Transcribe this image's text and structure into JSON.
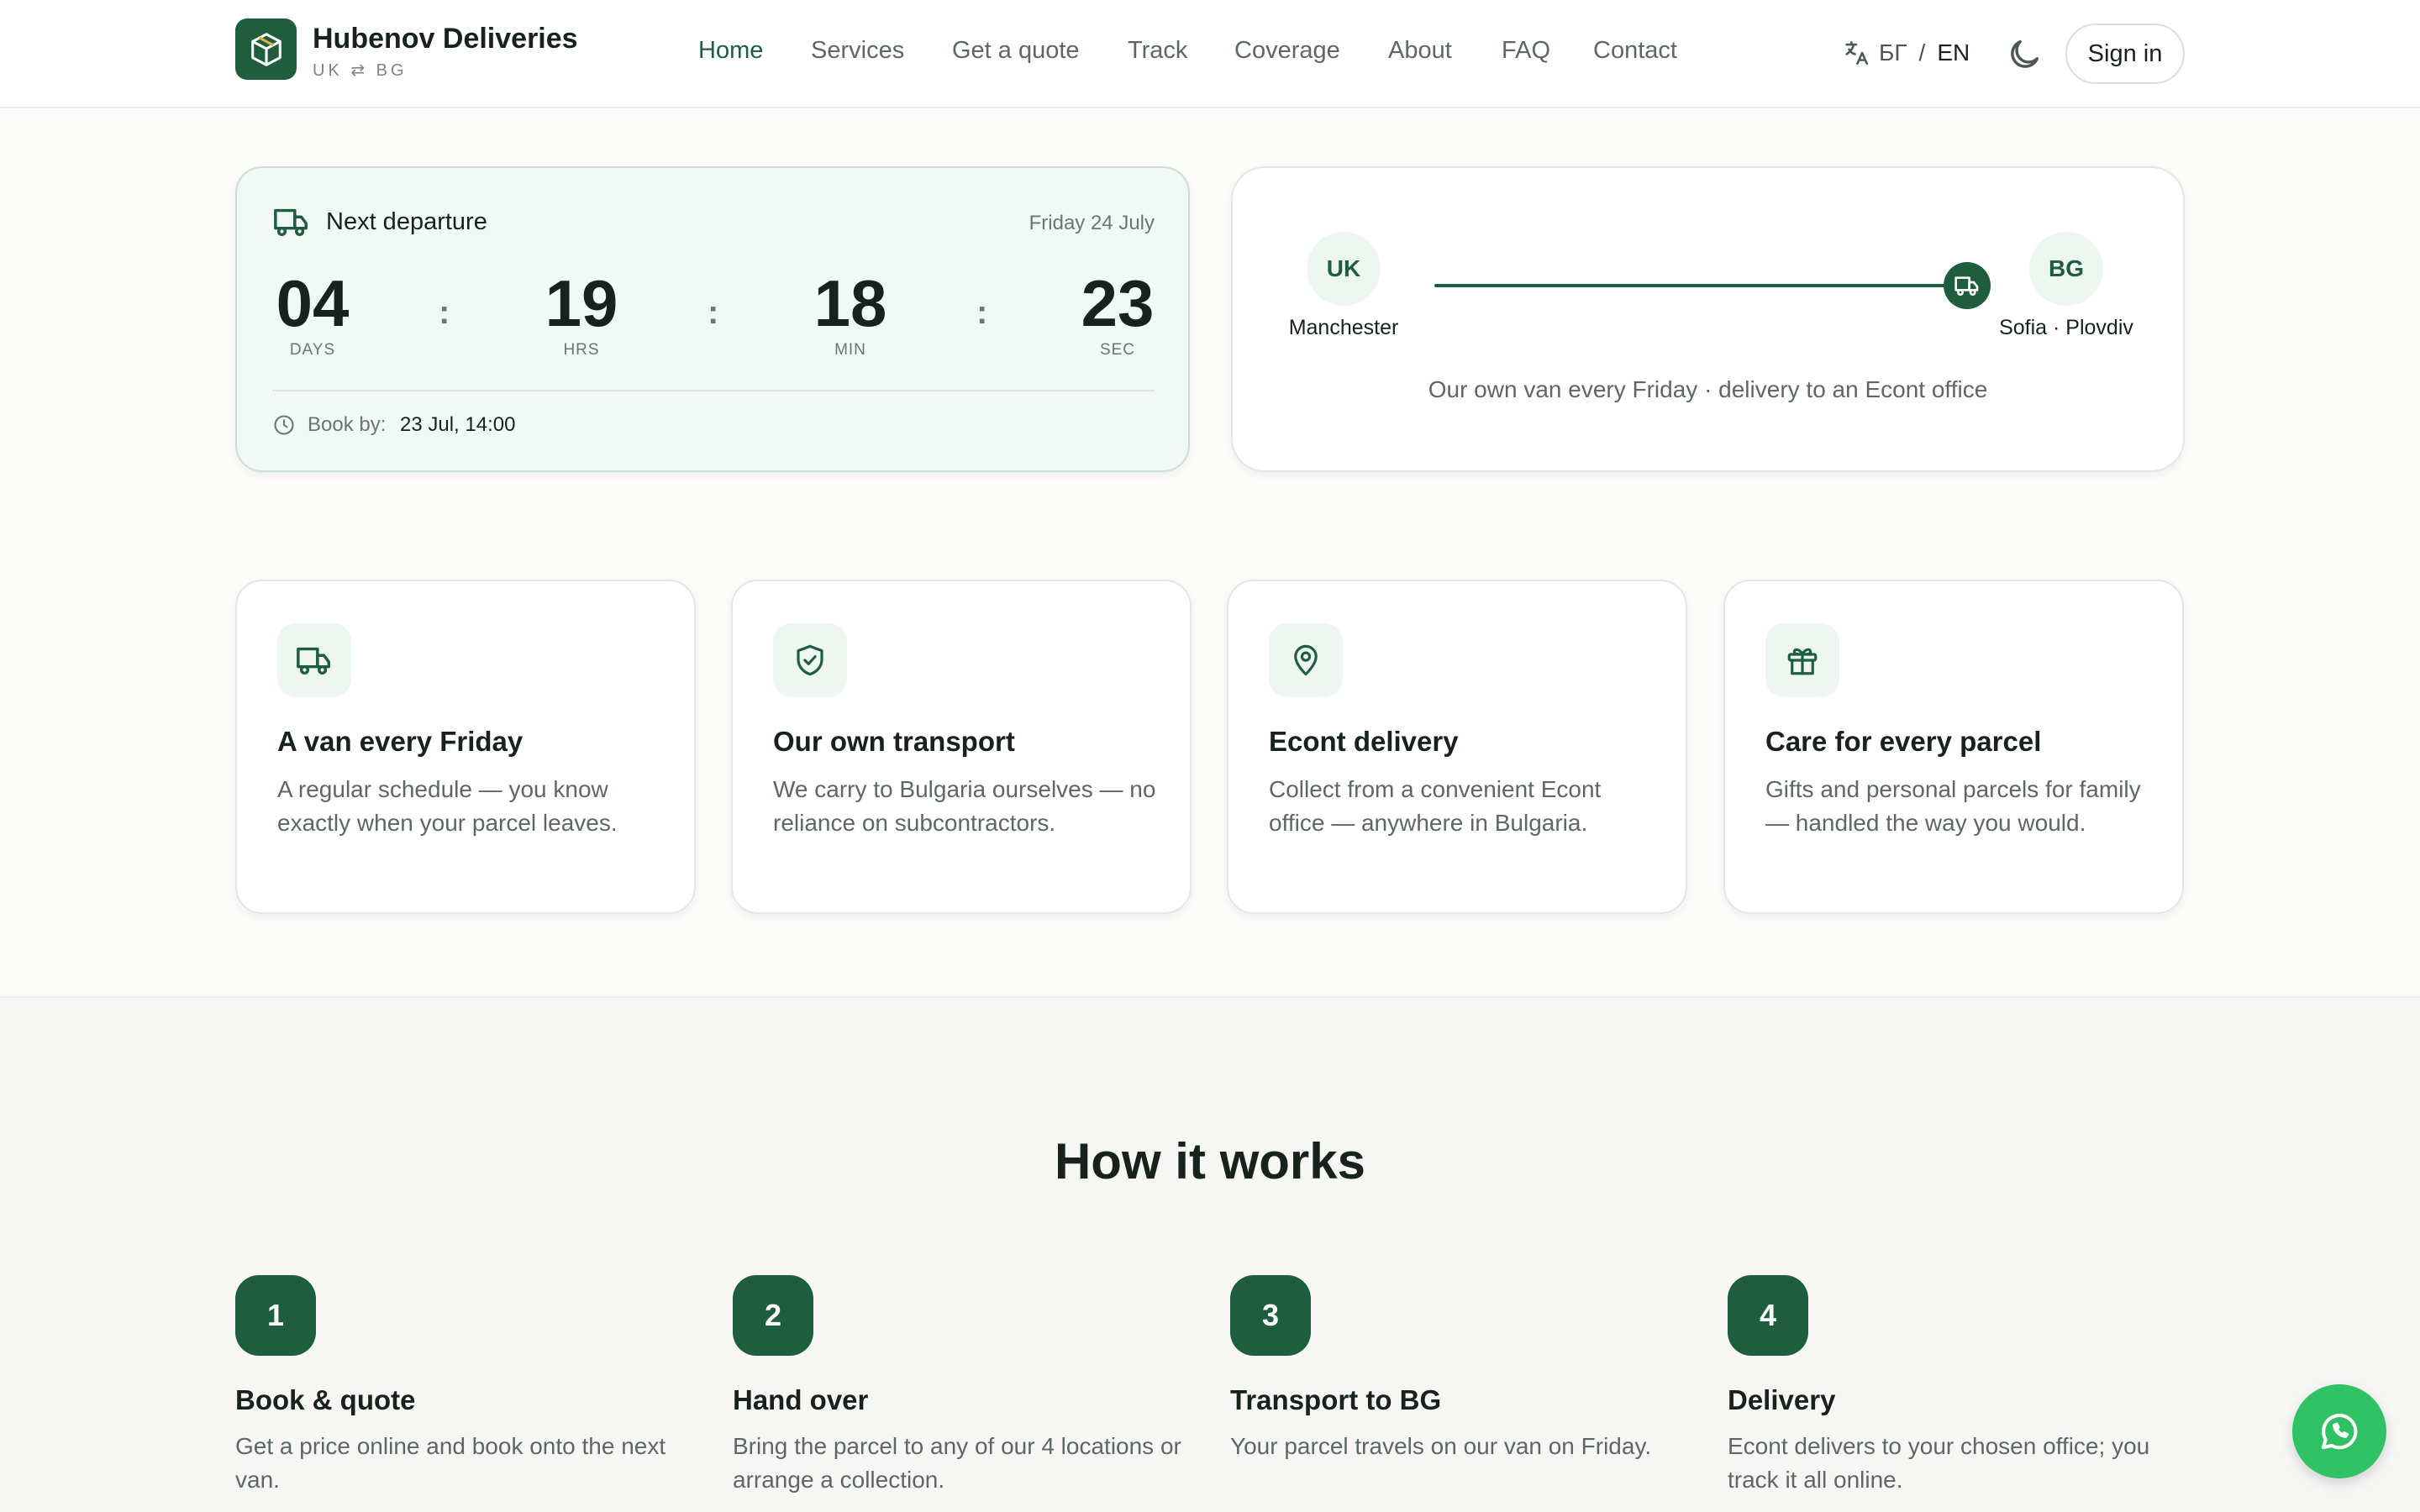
{
  "brand": {
    "name": "Hubenov Deliveries",
    "subtitle": "UK ⇄ BG"
  },
  "nav": {
    "items": [
      {
        "label": "Home",
        "active": true
      },
      {
        "label": "Services"
      },
      {
        "label": "Get a quote"
      },
      {
        "label": "Track"
      },
      {
        "label": "Coverage"
      },
      {
        "label": "About"
      },
      {
        "label": "FAQ"
      },
      {
        "label": "Contact"
      }
    ]
  },
  "language": {
    "bg": "БГ",
    "separator": "/",
    "en": "EN",
    "current": "EN"
  },
  "theme_toggle": {
    "icon": "moon-icon"
  },
  "signin": {
    "label": "Sign in"
  },
  "departure": {
    "title": "Next departure",
    "date": "Friday 24 July",
    "countdown": {
      "days": {
        "value": "04",
        "label": "DAYS"
      },
      "hours": {
        "value": "19",
        "label": "HRS"
      },
      "minutes": {
        "value": "18",
        "label": "MIN"
      },
      "seconds": {
        "value": "23",
        "label": "SEC"
      },
      "separator": ":"
    },
    "book_by_label": "Book by:",
    "book_by_value": "23 Jul, 14:00"
  },
  "route": {
    "origin": {
      "code": "UK",
      "city": "Manchester"
    },
    "destination": {
      "code": "BG",
      "city": "Sofia · Plovdiv"
    },
    "description": "Our own van every Friday · delivery to an Econt office"
  },
  "features": [
    {
      "icon": "truck-icon",
      "title": "A van every Friday",
      "desc": "A regular schedule — you know exactly when your parcel leaves."
    },
    {
      "icon": "shield-check-icon",
      "title": "Our own transport",
      "desc": "We carry to Bulgaria ourselves — no reliance on subcontractors."
    },
    {
      "icon": "map-pin-icon",
      "title": "Econt delivery",
      "desc": "Collect from a convenient Econt office — anywhere in Bulgaria."
    },
    {
      "icon": "gift-icon",
      "title": "Care for every parcel",
      "desc": "Gifts and personal parcels for family — handled the way you would."
    }
  ],
  "how": {
    "title": "How it works",
    "steps": [
      {
        "num": "1",
        "title": "Book & quote",
        "desc": "Get a price online and book onto the next van."
      },
      {
        "num": "2",
        "title": "Hand over",
        "desc": "Bring the parcel to any of our 4 locations or arrange a collection."
      },
      {
        "num": "3",
        "title": "Transport to BG",
        "desc": "Your parcel travels on our van on Friday."
      },
      {
        "num": "4",
        "title": "Delivery",
        "desc": "Econt delivers to your chosen office; you track it all online."
      }
    ]
  },
  "colors": {
    "brand": "#1e5e3f",
    "whatsapp": "#2fc163"
  },
  "whatsapp": {
    "icon": "whatsapp-icon"
  }
}
